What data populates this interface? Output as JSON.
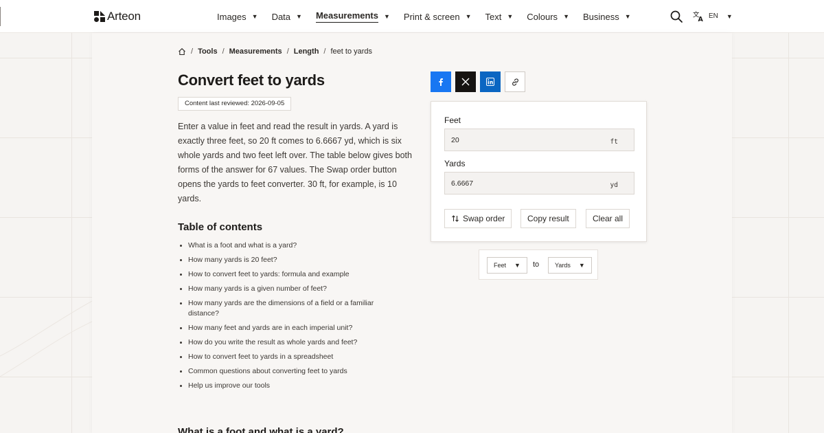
{
  "header": {
    "brand": "Arteon",
    "nav": [
      {
        "label": "Images",
        "active": false
      },
      {
        "label": "Data",
        "active": false
      },
      {
        "label": "Measurements",
        "active": true
      },
      {
        "label": "Print & screen",
        "active": false
      },
      {
        "label": "Text",
        "active": false
      },
      {
        "label": "Colours",
        "active": false
      },
      {
        "label": "Business",
        "active": false
      }
    ],
    "language": "EN"
  },
  "breadcrumb": {
    "items": [
      "Tools",
      "Measurements",
      "Length"
    ],
    "current": "feet to yards"
  },
  "page": {
    "title": "Convert feet to yards",
    "reviewed": "Content last reviewed: 2026-09-05",
    "intro": "Enter a value in feet and read the result in yards. A yard is exactly three feet, so 20 ft comes to 6.6667 yd, which is six whole yards and two feet left over. The table below gives both forms of the answer for 67 values. The Swap order button opens the yards to feet converter. 30 ft, for example, is 10 yards.",
    "toc_title": "Table of contents",
    "toc": [
      "What is a foot and what is a yard?",
      "How many yards is 20 feet?",
      "How to convert feet to yards: formula and example",
      "How many yards is a given number of feet?",
      "How many yards are the dimensions of a field or a familiar distance?",
      "How many feet and yards are in each imperial unit?",
      "How do you write the result as whole yards and feet?",
      "How to convert feet to yards in a spreadsheet",
      "Common questions about converting feet to yards",
      "Help us improve our tools"
    ],
    "next_heading": "What is a foot and what is a yard?"
  },
  "converter": {
    "from_label": "Feet",
    "from_value": "20",
    "from_unit": "ft",
    "to_label": "Yards",
    "to_value": "6.6667",
    "to_unit": "yd",
    "swap_label": "Swap order",
    "copy_label": "Copy result",
    "clear_label": "Clear all"
  },
  "unit_selector": {
    "from": "Feet",
    "to_word": "to",
    "to": "Yards"
  },
  "colors": {
    "facebook": "#1877f2",
    "x": "#161311",
    "linkedin": "#0a66c2",
    "text": "#1d1b19"
  }
}
